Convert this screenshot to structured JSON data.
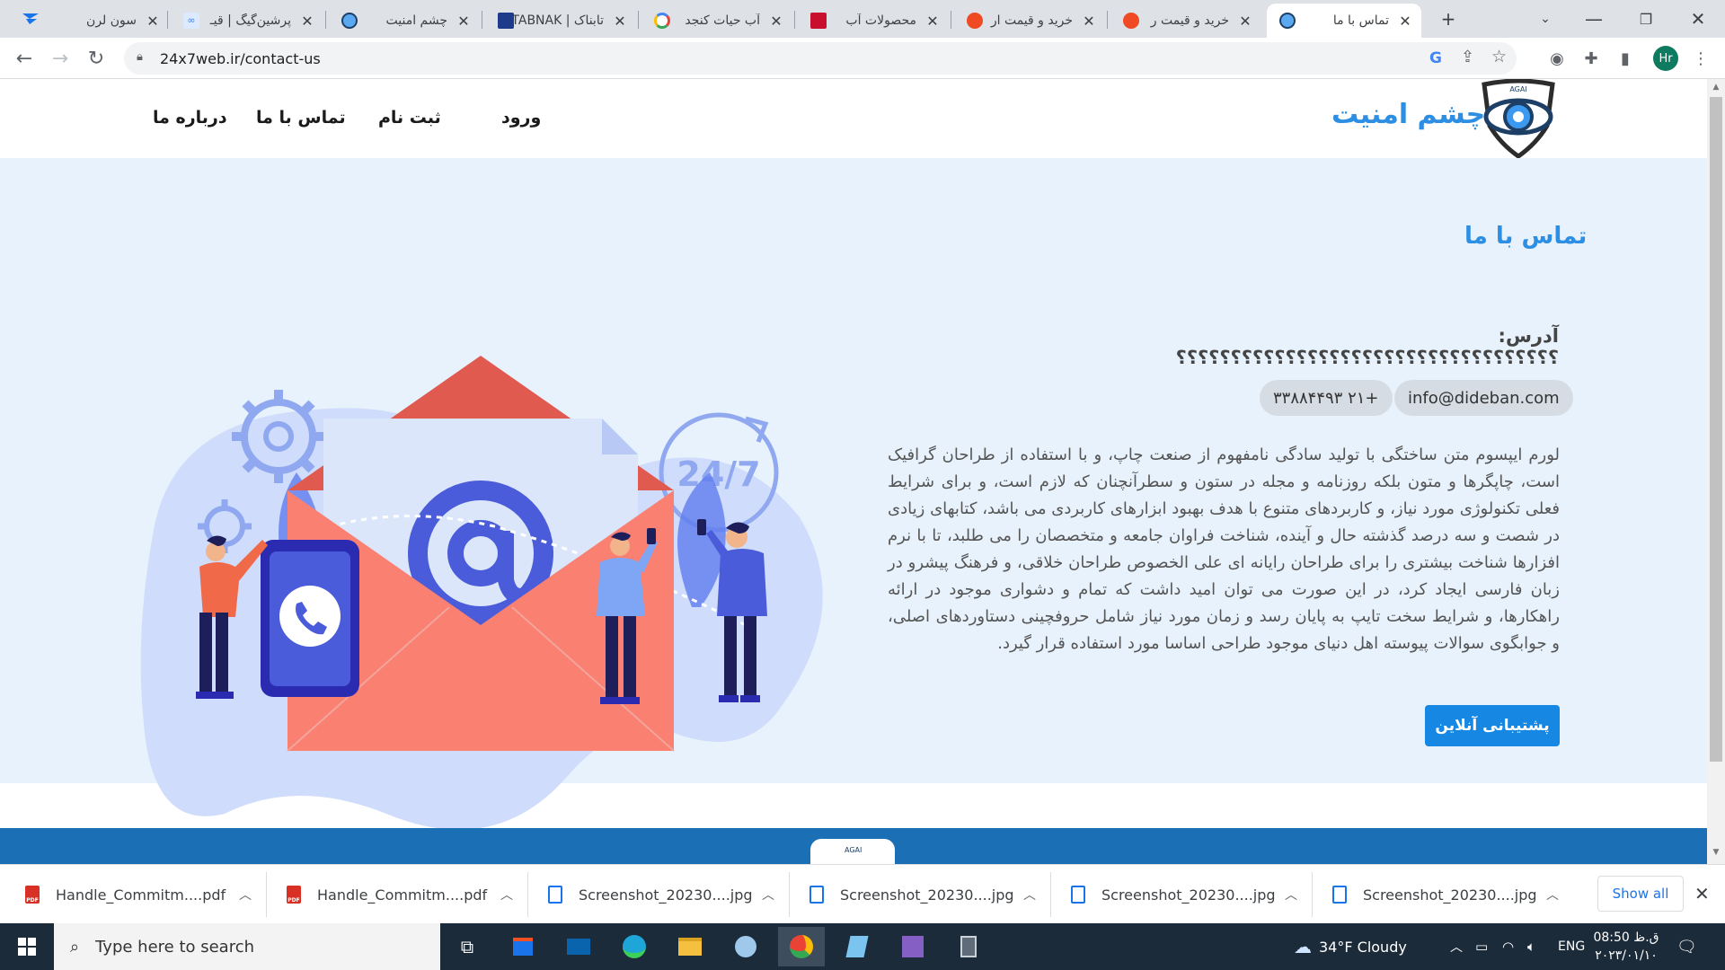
{
  "browser": {
    "tabs": [
      {
        "title": "سون لرن",
        "icon": "sevenlearn-icon"
      },
      {
        "title": "پرشین‌گیگ | قیـ",
        "icon": "persiangig-icon"
      },
      {
        "title": "چشم امنیت",
        "icon": "eye-logo-icon"
      },
      {
        "title": "تابناک | TABNAK",
        "icon": "tabnak-icon"
      },
      {
        "title": "آب حیات کنجد",
        "icon": "google-icon"
      },
      {
        "title": "محصولات آب",
        "icon": "red-square-icon"
      },
      {
        "title": "خرید و قیمت ار",
        "icon": "digikala-icon"
      },
      {
        "title": "خرید و قیمت ر",
        "icon": "digikala-icon"
      },
      {
        "title": "تماس با ما",
        "icon": "eye-logo-icon",
        "active": true
      }
    ],
    "url": "24x7web.ir/contact-us",
    "profile_initials": "Hr"
  },
  "site": {
    "brand": "چشم امنیت",
    "logo_text": "AGAI",
    "nav": {
      "about": "درباره ما",
      "contact": "تماس با ما",
      "register": "ثبت نام",
      "login": "ورود"
    }
  },
  "contact": {
    "title": "تماس با ما",
    "address": "آدرس: ؟؟؟؟؟؟؟؟؟؟؟؟؟؟؟؟؟؟؟؟؟؟؟؟؟؟؟؟؟؟؟؟؟؟؟",
    "email": "info@dideban.com",
    "phone": "+۲۱ ۳۳۸۸۴۴۹۳",
    "body": "لورم ایپسوم متن ساختگی با تولید سادگی نامفهوم از صنعت چاپ، و با استفاده از طراحان گرافیک است، چاپگرها و متون بلکه روزنامه و مجله در ستون و سطرآنچنان که لازم است، و برای شرایط فعلی تکنولوژی مورد نیاز، و کاربردهای متنوع با هدف بهبود ابزارهای کاربردی می باشد، کتابهای زیادی در شصت و سه درصد گذشته حال و آینده، شناخت فراوان جامعه و متخصصان را می طلبد، تا با نرم افزارها شناخت بیشتری را برای طراحان رایانه ای علی الخصوص طراحان خلاقی، و فرهنگ پیشرو در زبان فارسی ایجاد کرد، در این صورت می توان امید داشت که تمام و دشواری موجود در ارائه راهکارها، و شرایط سخت تایپ به پایان رسد و زمان مورد نیاز شامل حروفچینی دستاوردهای اصلی، و جوابگوی سوالات پیوسته اهل دنیای موجود طراحی اساسا مورد استفاده قرار گیرد.",
    "support_button": "پشتیبانی آنلاین",
    "illustration_text": "24/7"
  },
  "downloads": {
    "items": [
      {
        "name": "Handle_Commitm....pdf",
        "type": "pdf"
      },
      {
        "name": "Handle_Commitm....pdf",
        "type": "pdf"
      },
      {
        "name": "Screenshot_20230....jpg",
        "type": "jpg"
      },
      {
        "name": "Screenshot_20230....jpg",
        "type": "jpg"
      },
      {
        "name": "Screenshot_20230....jpg",
        "type": "jpg"
      },
      {
        "name": "Screenshot_20230....jpg",
        "type": "jpg"
      }
    ],
    "show_all": "Show all"
  },
  "taskbar": {
    "search_placeholder": "Type here to search",
    "weather": "34°F  Cloudy",
    "lang": "ENG",
    "time": "08:50 ق.ظ",
    "date": "۲۰۲۳/۰۱/۱۰"
  },
  "colors": {
    "brand_blue": "#2d8fe3",
    "button_blue": "#1687e3",
    "section_bg": "#e8f2fc",
    "footer_blue": "#1b6fb5"
  }
}
